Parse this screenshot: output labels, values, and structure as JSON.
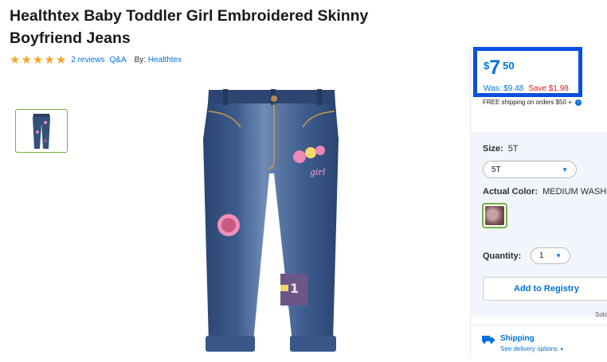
{
  "product": {
    "title": "Healthtex Baby Toddler Girl Embroidered Skinny Boyfriend Jeans",
    "rating": 5,
    "reviews_link": "2 reviews",
    "qa_link": "Q&A",
    "by_label": "By:",
    "brand": "Healthtex"
  },
  "price": {
    "currency": "$",
    "dollars": "7",
    "cents": "50",
    "was": "Was: $9.48",
    "save": "Save $1.98",
    "free_shipping": "FREE shipping on orders $50 +",
    "info_icon": "i"
  },
  "options": {
    "size_label": "Size:",
    "size_value": "5T",
    "size_selected": "5T",
    "color_label": "Actual Color:",
    "color_value": "MEDIUM WASH",
    "quantity_label": "Quantity:",
    "quantity_value": "1"
  },
  "actions": {
    "registry_label": "Add to Registry",
    "sold_text": "Sold"
  },
  "shipping": {
    "title": "Shipping",
    "delivery_link": "See delivery options"
  },
  "colors": {
    "accent_blue": "#0071dc",
    "save_red": "#de1c24",
    "star_gold": "#f5a623",
    "select_green": "#76b041",
    "highlight_box": "#0a4fe0"
  },
  "icons": {
    "stars": "star-icon",
    "caret": "chevron-down-icon",
    "truck": "truck-icon"
  }
}
